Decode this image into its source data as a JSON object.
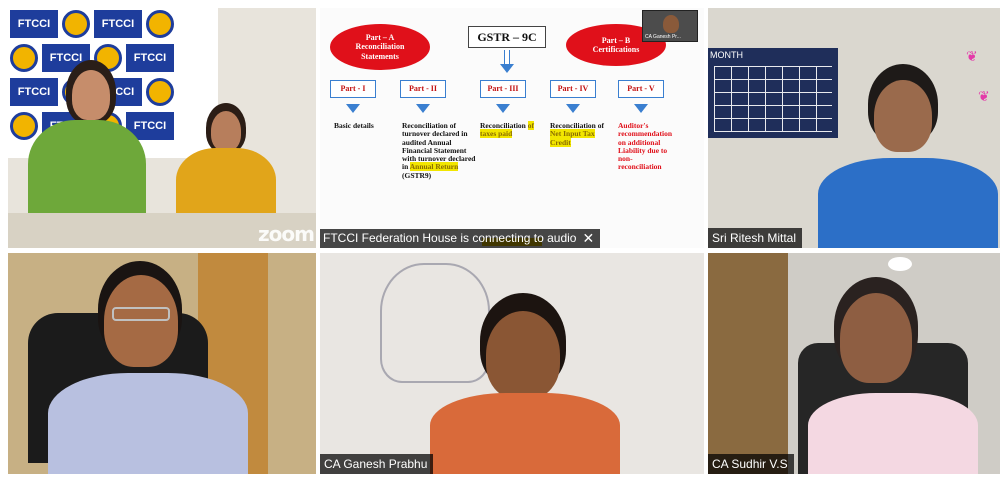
{
  "participants": [
    {
      "id": "t1",
      "name": "",
      "watermark": "zoom"
    },
    {
      "id": "t2",
      "name": "",
      "status": "FTCCI Federation House is connecting to audio"
    },
    {
      "id": "t3",
      "name": "Sri Ritesh Mittal"
    },
    {
      "id": "t4",
      "name": ""
    },
    {
      "id": "t5",
      "name": "CA Ganesh Prabhu"
    },
    {
      "id": "t6",
      "name": "CA Sudhir V.S"
    }
  ],
  "logo_wall": {
    "label": "FTCCI"
  },
  "calendar": {
    "label": "MONTH"
  },
  "slide": {
    "title": "GSTR – 9C",
    "part_a": "Part – A Reconciliation Statements",
    "part_b": "Part – B Certifications",
    "thumbnail_label": "CA Ganesh Pr...",
    "parts": [
      {
        "label": "Part - I",
        "text": "Basic details"
      },
      {
        "label": "Part - II",
        "text": "Reconciliation of turnover declared in audited Annual Financial Statement with turnover declared in",
        "highlight": "Annual Return",
        "suffix": "(GSTR9)"
      },
      {
        "label": "Part - III",
        "text": "Reconciliation",
        "highlight": "of taxes paid"
      },
      {
        "label": "Part - IV",
        "text": "Reconciliation of",
        "highlight": "Net Input Tax Credit"
      },
      {
        "label": "Part - V",
        "text": "Auditor's recommendation on additional Liability due to non-reconciliation"
      }
    ]
  },
  "colors": {
    "slide_red": "#e0101a",
    "slide_blue": "#3a7fd0",
    "highlight": "#f2e600",
    "name_tag_bg": "#000000"
  }
}
